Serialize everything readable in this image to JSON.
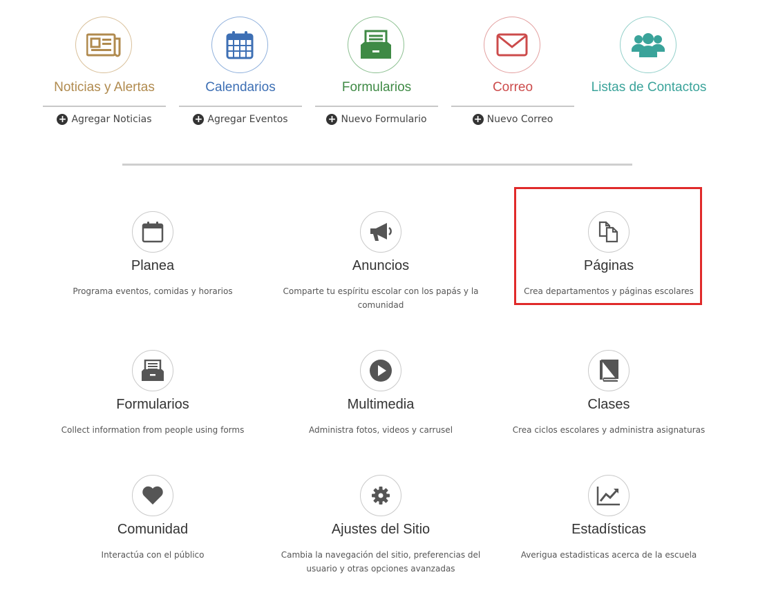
{
  "quick_links": [
    {
      "title": "Noticias y Alertas",
      "action": "Agregar Noticias",
      "icon": "newspaper-icon",
      "color": "#b08a4e",
      "border": "#d9c09a"
    },
    {
      "title": "Calendarios",
      "action": "Agregar Eventos",
      "icon": "calendar-icon",
      "color": "#3d6fb4",
      "border": "#8fb0dc"
    },
    {
      "title": "Formularios",
      "action": "Nuevo Formulario",
      "icon": "form-tray-icon",
      "color": "#3f8a45",
      "border": "#8cc091"
    },
    {
      "title": "Correo",
      "action": "Nuevo Correo",
      "icon": "envelope-icon",
      "color": "#cc4b4b",
      "border": "#e3a0a0"
    },
    {
      "title": "Listas de Contactos",
      "action": "",
      "icon": "users-icon",
      "color": "#3aa39a",
      "border": "#93d0ca"
    }
  ],
  "modules": [
    {
      "title": "Planea",
      "description": "Programa eventos, comidas y horarios",
      "icon": "calendar-icon"
    },
    {
      "title": "Anuncios",
      "description": "Comparte tu espíritu escolar con los papás y la comunidad",
      "icon": "megaphone-icon"
    },
    {
      "title": "Páginas",
      "description": "Crea departamentos y páginas escolares",
      "icon": "pages-icon"
    },
    {
      "title": "Formularios",
      "description": "Collect information from people using forms",
      "icon": "form-tray-icon"
    },
    {
      "title": "Multimedia",
      "description": "Administra fotos, videos y carrusel",
      "icon": "play-icon"
    },
    {
      "title": "Clases",
      "description": "Crea ciclos escolares y administra asignaturas",
      "icon": "book-icon"
    },
    {
      "title": "Comunidad",
      "description": "Interactúa con el público",
      "icon": "heart-icon"
    },
    {
      "title": "Ajustes del Sitio",
      "description": "Cambia la navegación del sitio, preferencias del usuario y otras opciones avanzadas",
      "icon": "gear-icon"
    },
    {
      "title": "Estadísticas",
      "description": "Averigua estadisticas acerca de la escuela",
      "icon": "chart-line-icon"
    }
  ],
  "highlighted_module": "Páginas"
}
